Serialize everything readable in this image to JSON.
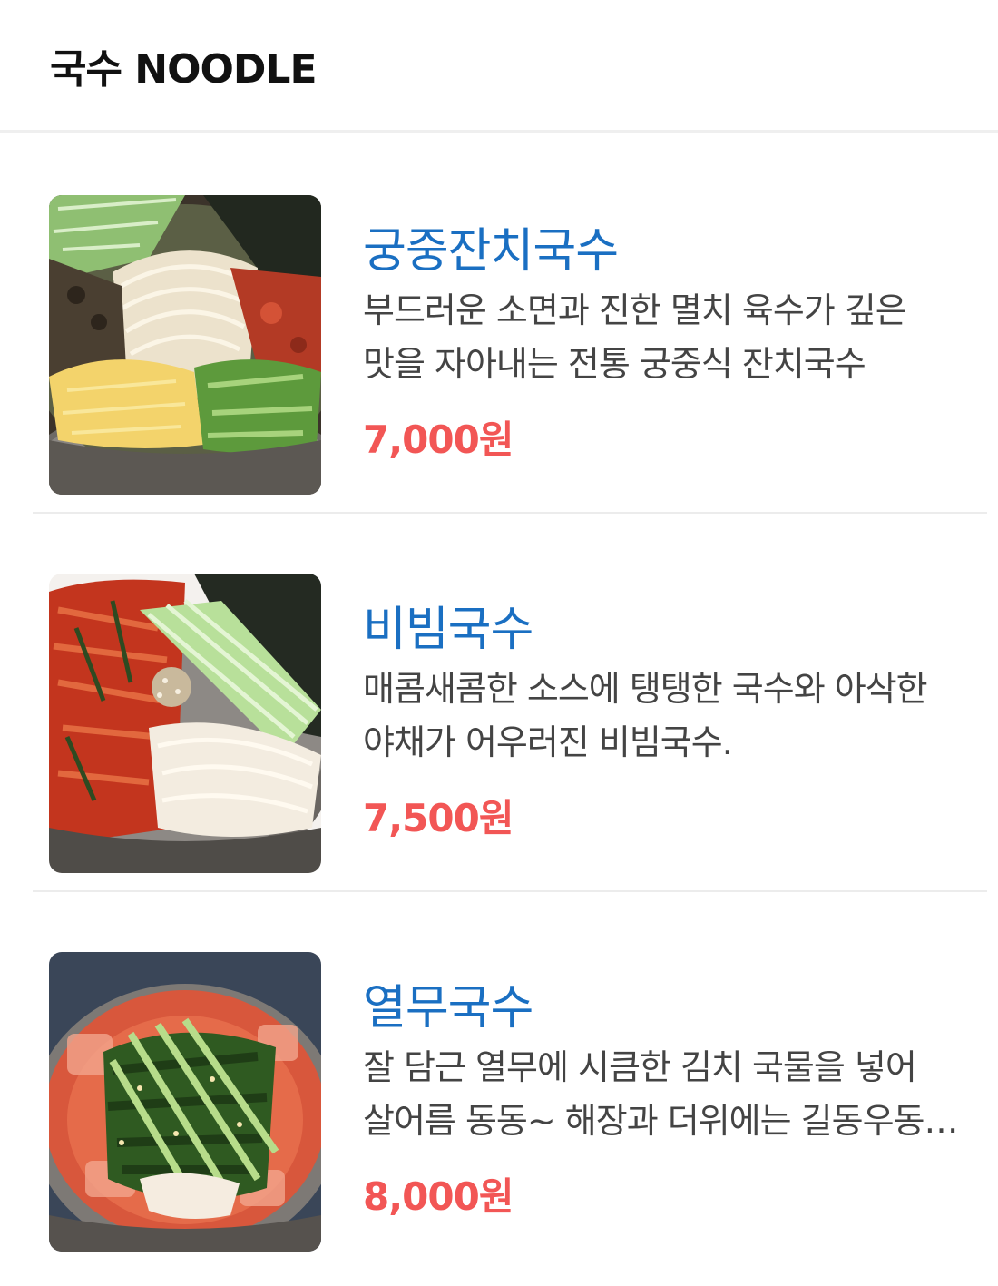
{
  "header": {
    "title": "국수 NOODLE"
  },
  "menu": {
    "items": [
      {
        "name": "궁중잔치국수",
        "description": "부드러운 소면과 진한 멸치 육수가 깊은 맛을 자아내는 전통 궁중식 잔치국수",
        "price": "7,000원",
        "image_icon": "janchi-guksu-photo"
      },
      {
        "name": "비빔국수",
        "description": "매콤새콤한 소스에 탱탱한 국수와 아삭한 야채가 어우러진 비빔국수.",
        "price": "7,500원",
        "image_icon": "bibim-guksu-photo"
      },
      {
        "name": "열무국수",
        "description": "잘 담근 열무에 시큼한 김치 국물을 넣어 살어름 동동~ 해장과 더위에는 길동우동의 열무국수",
        "price": "8,000원",
        "image_icon": "yeolmu-guksu-photo"
      }
    ]
  },
  "colors": {
    "name": "#1a6fc2",
    "price": "#f25655",
    "description": "#444444",
    "divider": "#ececec"
  }
}
